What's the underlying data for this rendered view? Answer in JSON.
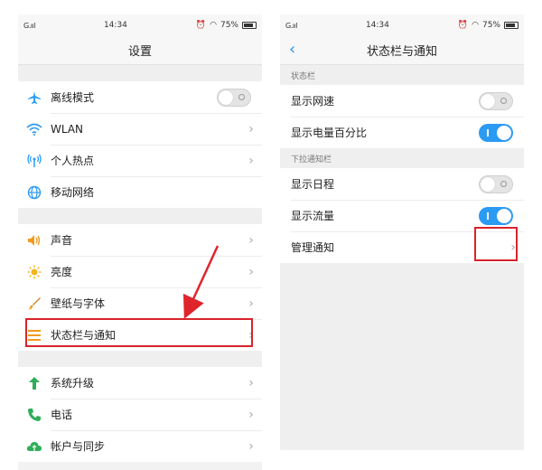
{
  "left": {
    "status": {
      "signal": "G.ııl",
      "time": "14:34",
      "battery": "75%"
    },
    "title": "设置",
    "groups": [
      [
        {
          "label": "离线模式",
          "icon": "airplane-icon",
          "control": "toggle-off"
        },
        {
          "label": "WLAN",
          "icon": "wifi-icon",
          "control": "chevron"
        },
        {
          "label": "个人热点",
          "icon": "hotspot-icon",
          "control": "chevron"
        },
        {
          "label": "移动网络",
          "icon": "globe-icon",
          "control": "none"
        }
      ],
      [
        {
          "label": "声音",
          "icon": "speaker-icon",
          "control": "chevron"
        },
        {
          "label": "亮度",
          "icon": "sun-icon",
          "control": "chevron"
        },
        {
          "label": "壁纸与字体",
          "icon": "brush-icon",
          "control": "chevron"
        },
        {
          "label": "状态栏与通知",
          "icon": "statusbar-icon",
          "control": "chevron"
        }
      ],
      [
        {
          "label": "系统升级",
          "icon": "arrow-up-icon",
          "control": "chevron"
        },
        {
          "label": "电话",
          "icon": "phone-icon",
          "control": "chevron"
        },
        {
          "label": "帐户与同步",
          "icon": "cloud-icon",
          "control": "chevron"
        }
      ]
    ]
  },
  "right": {
    "status": {
      "signal": "G.ııl",
      "time": "14:34",
      "battery": "75%"
    },
    "title": "状态栏与通知",
    "sections": [
      {
        "header": "状态栏",
        "rows": [
          {
            "label": "显示网速",
            "control": "toggle-off"
          },
          {
            "label": "显示电量百分比",
            "control": "toggle-on"
          }
        ]
      },
      {
        "header": "下拉通知栏",
        "rows": [
          {
            "label": "显示日程",
            "control": "toggle-off"
          },
          {
            "label": "显示流量",
            "control": "toggle-on"
          },
          {
            "label": "管理通知",
            "control": "chevron"
          }
        ]
      }
    ]
  },
  "colors": {
    "accent": "#2b9af3",
    "highlight": "#d8232a",
    "arrow": "#e0242b"
  }
}
